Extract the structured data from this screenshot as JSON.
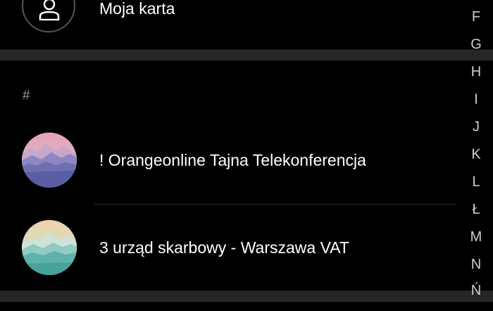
{
  "my_card": {
    "label": "Moja karta",
    "icon": "person-outline-icon"
  },
  "section": {
    "header": "#"
  },
  "contacts": [
    {
      "name": "! Orangeonline Tajna Telekonferencja",
      "avatar": "mountain-avatar-purple"
    },
    {
      "name": "3 urząd skarbowy - Warszawa VAT",
      "avatar": "mountain-avatar-teal"
    }
  ],
  "alphabet_index": [
    "F",
    "G",
    "H",
    "I",
    "J",
    "K",
    "L",
    "Ł",
    "M",
    "N",
    "Ń"
  ],
  "colors": {
    "background": "#000000",
    "band": "#262626",
    "text": "#ffffff",
    "muted_text": "#9a9a9a",
    "index_text": "#cfcfcf"
  }
}
